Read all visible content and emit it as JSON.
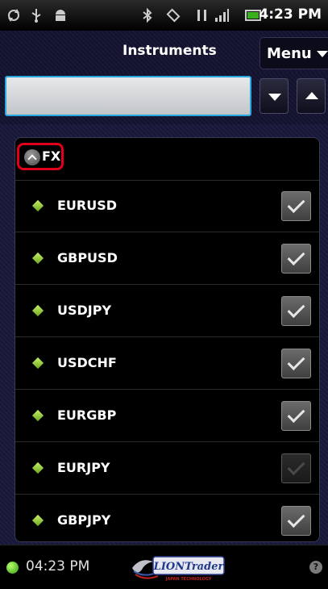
{
  "status_bar": {
    "time": "4:23 PM",
    "icons": [
      "sync-icon",
      "usb-icon",
      "android-debug-icon",
      "bluetooth-icon",
      "vibrate-icon",
      "data-arrows-icon",
      "signal-icon",
      "battery-icon"
    ]
  },
  "header": {
    "title": "Instruments",
    "menu_label": "Menu"
  },
  "search": {
    "value": "",
    "placeholder": ""
  },
  "group": {
    "label": "FX",
    "items": [
      {
        "symbol": "EURUSD",
        "checked": true,
        "enabled": true
      },
      {
        "symbol": "GBPUSD",
        "checked": true,
        "enabled": true
      },
      {
        "symbol": "USDJPY",
        "checked": true,
        "enabled": true
      },
      {
        "symbol": "USDCHF",
        "checked": true,
        "enabled": true
      },
      {
        "symbol": "EURGBP",
        "checked": true,
        "enabled": true
      },
      {
        "symbol": "EURJPY",
        "checked": true,
        "enabled": false
      },
      {
        "symbol": "GBPJPY",
        "checked": true,
        "enabled": true
      }
    ]
  },
  "footer": {
    "time": "04:23 PM",
    "logo_text": "LIONTrader",
    "logo_subtext": "JAPAN TECHNOLOGY",
    "help_glyph": "?"
  },
  "colors": {
    "accent_blue": "#2aa7e0",
    "highlight_red": "#e0001a",
    "status_green": "#3aa81a",
    "item_diamond": "#8cc63f"
  }
}
